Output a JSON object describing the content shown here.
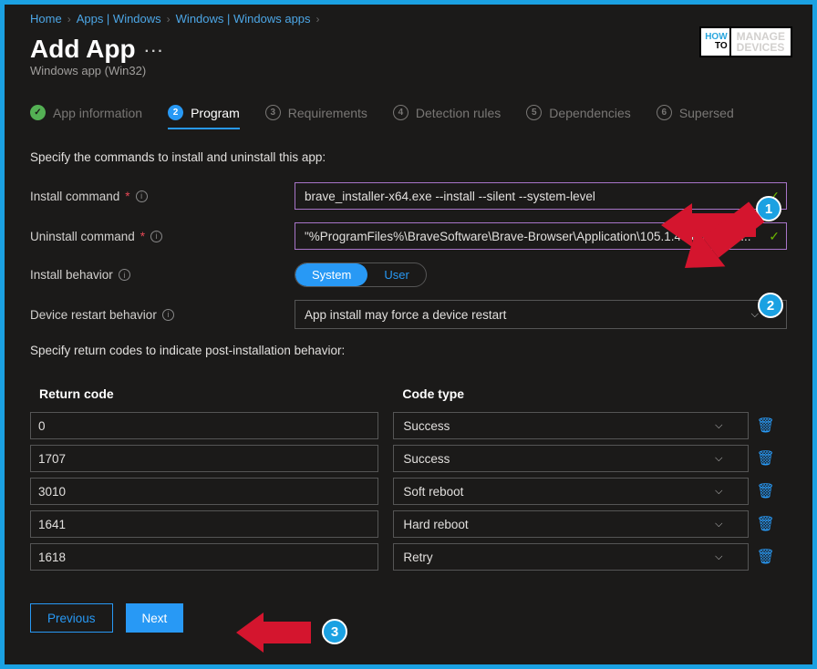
{
  "breadcrumb": {
    "home": "Home",
    "apps": "Apps | Windows",
    "winapps": "Windows | Windows apps"
  },
  "header": {
    "title": "Add App",
    "subtitle": "Windows app (Win32)"
  },
  "tabs": {
    "t1": "App information",
    "t2": "Program",
    "t3": "Requirements",
    "t4": "Detection rules",
    "t5": "Dependencies",
    "t6": "Supersed"
  },
  "section1_desc": "Specify the commands to install and uninstall this app:",
  "labels": {
    "install_cmd": "Install command",
    "uninstall_cmd": "Uninstall command",
    "install_behavior": "Install behavior",
    "restart_behavior": "Device restart behavior"
  },
  "fields": {
    "install_cmd": "brave_installer-x64.exe --install --silent --system-level",
    "uninstall_cmd": "\"%ProgramFiles%\\BraveSoftware\\Brave-Browser\\Application\\105.1.43.89\\Install...",
    "toggle_system": "System",
    "toggle_user": "User",
    "restart_value": "App install may force a device restart"
  },
  "section2_desc": "Specify return codes to indicate post-installation behavior:",
  "table": {
    "header_code": "Return code",
    "header_type": "Code type",
    "rows": [
      {
        "code": "0",
        "type": "Success"
      },
      {
        "code": "1707",
        "type": "Success"
      },
      {
        "code": "3010",
        "type": "Soft reboot"
      },
      {
        "code": "1641",
        "type": "Hard reboot"
      },
      {
        "code": "1618",
        "type": "Retry"
      }
    ]
  },
  "buttons": {
    "previous": "Previous",
    "next": "Next"
  },
  "logo": {
    "how": "HOW",
    "to": "TO",
    "manage": "MANAGE",
    "devices": "DEVICES"
  },
  "annotations": {
    "n1": "1",
    "n2": "2",
    "n3": "3"
  }
}
